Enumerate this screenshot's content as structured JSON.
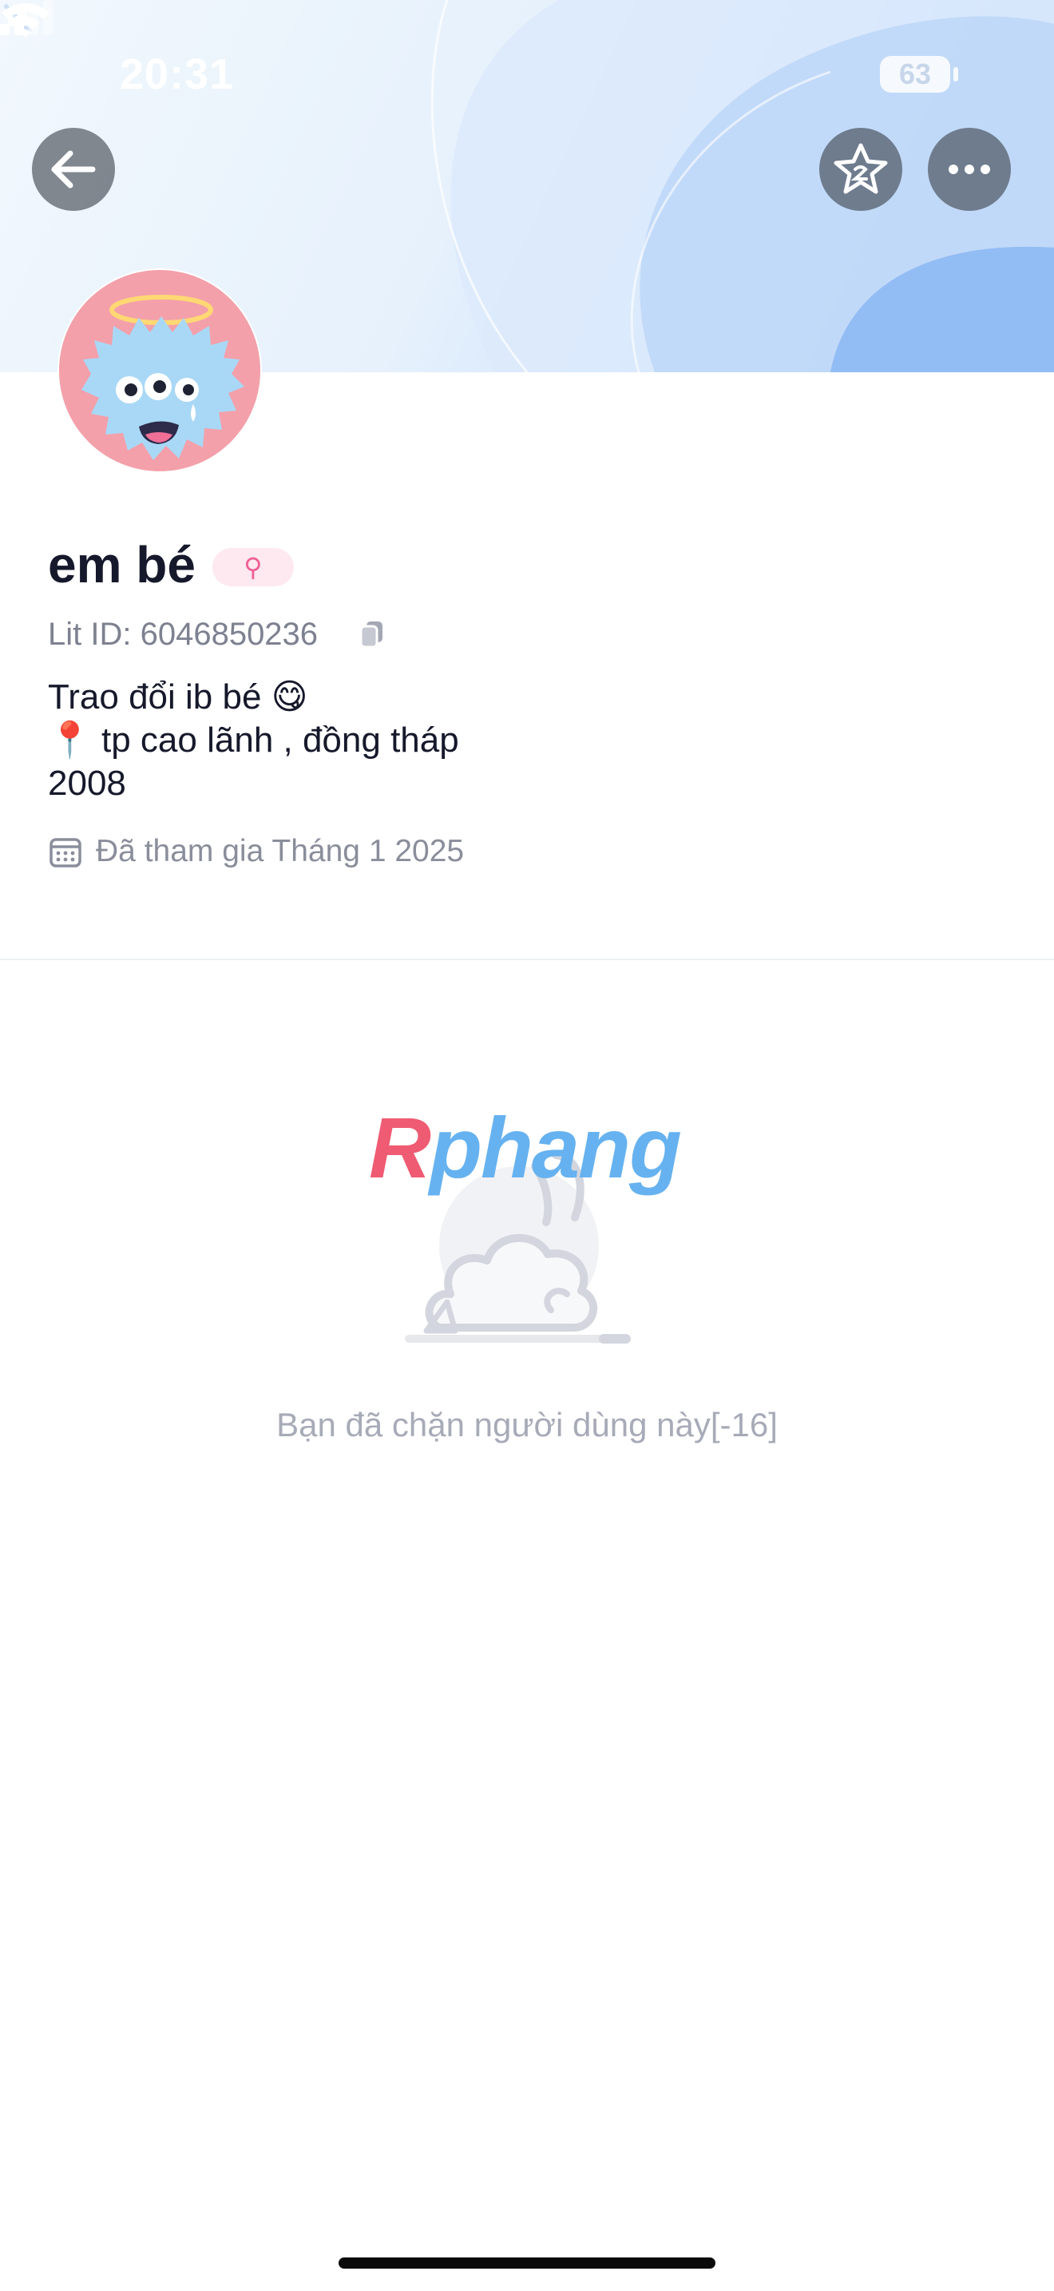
{
  "status_bar": {
    "time": "20:31",
    "battery": "63"
  },
  "profile": {
    "name": "em bé",
    "gender_symbol": "⚲",
    "lit_id": "Lit ID: 6046850236",
    "bio_lines": [
      "Trao đổi ib bé 😋",
      "📍 tp cao lãnh , đồng tháp",
      "2008"
    ],
    "joined": "Đã tham gia Tháng 1 2025"
  },
  "watermark": {
    "first_letter": "R",
    "rest": "phang"
  },
  "blocked_message": "Bạn đã chặn người dùng này[-16]",
  "icons": {
    "back": "arrow-left-icon",
    "star": "star-icon",
    "more": "more-dots-icon",
    "copy": "copy-icon",
    "calendar": "calendar-icon"
  },
  "colors": {
    "gender_badge_bg": "#fde9ef",
    "gender_symbol": "#ef5f93",
    "avatar_bg": "#f3a0aa"
  }
}
